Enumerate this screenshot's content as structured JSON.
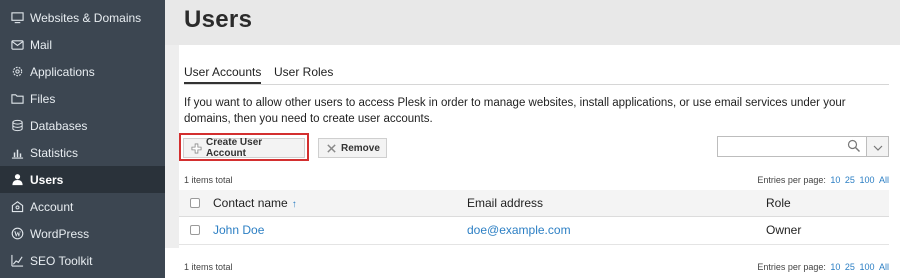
{
  "sidebar": {
    "items": [
      {
        "label": "Websites & Domains",
        "icon": "monitor-icon"
      },
      {
        "label": "Mail",
        "icon": "envelope-icon"
      },
      {
        "label": "Applications",
        "icon": "gear-icon"
      },
      {
        "label": "Files",
        "icon": "folder-icon"
      },
      {
        "label": "Databases",
        "icon": "database-icon"
      },
      {
        "label": "Statistics",
        "icon": "bar-chart-icon"
      },
      {
        "label": "Users",
        "icon": "user-icon",
        "active": true
      },
      {
        "label": "Account",
        "icon": "account-icon"
      },
      {
        "label": "WordPress",
        "icon": "wordpress-icon"
      },
      {
        "label": "SEO Toolkit",
        "icon": "seo-chart-icon"
      }
    ]
  },
  "header": {
    "title": "Users"
  },
  "tabs": [
    {
      "label": "User Accounts",
      "active": true
    },
    {
      "label": "User Roles",
      "active": false
    }
  ],
  "description": "If you want to allow other users to access Plesk in order to manage websites, install applications, or use email services under your domains, then you need to create user accounts.",
  "toolbar": {
    "create_label": "Create User Account",
    "remove_label": "Remove",
    "search_value": ""
  },
  "summary": {
    "items_total": "1 items total",
    "entries_label": "Entries per page:",
    "entries_options": [
      "10",
      "25",
      "100",
      "All"
    ]
  },
  "table": {
    "columns": [
      "Contact name",
      "Email address",
      "Role"
    ],
    "sort_indicator": "↑",
    "rows": [
      {
        "name": "John Doe",
        "email": "doe@example.com",
        "role": "Owner"
      }
    ]
  },
  "colors": {
    "sidebar_bg": "#3c4651",
    "sidebar_active_bg": "#2a323a",
    "link": "#2c7fc4",
    "highlight": "#d32f2f"
  }
}
